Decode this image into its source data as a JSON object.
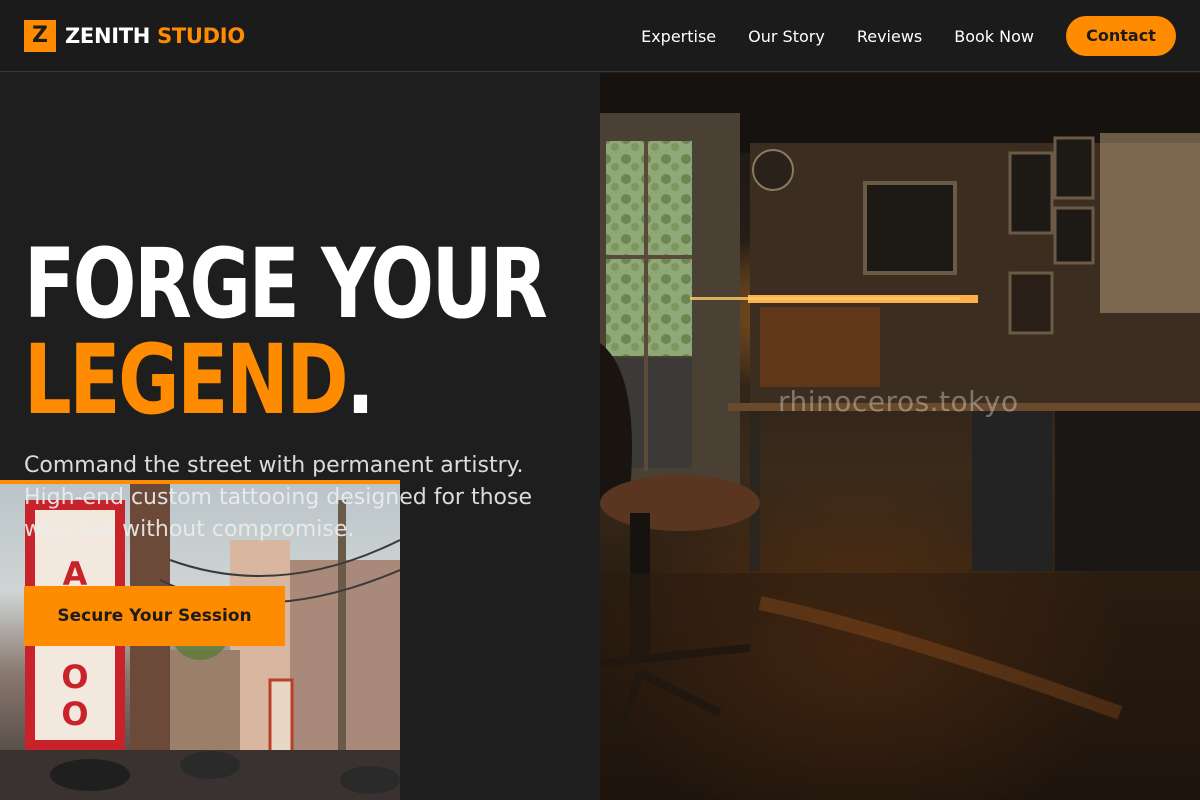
{
  "brand": {
    "mark": "Z",
    "name_first": "ZENITH",
    "name_second": "STUDIO"
  },
  "nav": {
    "links": [
      {
        "label": "Expertise"
      },
      {
        "label": "Our Story"
      },
      {
        "label": "Reviews"
      },
      {
        "label": "Book Now"
      }
    ],
    "contact_label": "Contact"
  },
  "hero": {
    "title_line1": "FORGE YOUR",
    "title_line2_accent": "LEGEND",
    "title_line2_dot": ".",
    "subtitle": "Command the street with permanent artistry. High-end custom tattooing designed for those who live without compromise.",
    "cta_label": "Secure Your Session"
  },
  "studio_photo": {
    "watermark": "rhinoceros.tokyo"
  },
  "colors": {
    "accent": "#ff8c00",
    "background": "#1e1e1e",
    "nav_bg": "#1b1b1b"
  }
}
